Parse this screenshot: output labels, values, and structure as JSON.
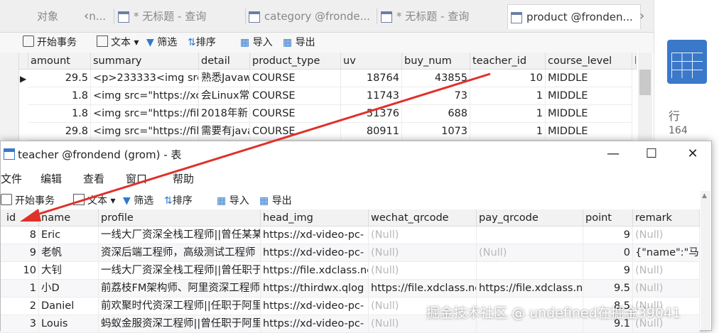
{
  "bg": {
    "tabs": [
      {
        "label": "对象"
      },
      {
        "label": "n..."
      },
      {
        "label": "* 无标题 - 查询"
      },
      {
        "label": "category @fronde..."
      },
      {
        "label": "* 无标题 - 查询"
      },
      {
        "label": "product @fronden..."
      }
    ],
    "toolbar": {
      "begin": "开始事务",
      "text": "文本",
      "filter": "筛选",
      "sort": "排序",
      "import": "导入",
      "export": "导出"
    },
    "columns": [
      "amount",
      "summary",
      "detail",
      "product_type",
      "uv",
      "buy_num",
      "teacher_id",
      "course_level",
      "l"
    ],
    "rows": [
      [
        "29.5",
        "<p>233333<img src",
        "熟悉Javaw",
        "COURSE",
        "18764",
        "43855",
        "10",
        "MIDDLE"
      ],
      [
        "1.8",
        "<img src=\"https://xc",
        "会Linux常",
        "COURSE",
        "11743",
        "73",
        "1",
        "MIDDLE"
      ],
      [
        "1.8",
        "<img src=\"https://fil",
        "2018年新",
        "COURSE",
        "51376",
        "688",
        "1",
        "MIDDLE"
      ],
      [
        "29.8",
        "<img src=\"https://fil",
        "需要有java",
        "COURSE",
        "80911",
        "1073",
        "1",
        "MIDDLE"
      ]
    ],
    "side": {
      "label": "行",
      "count": "164"
    }
  },
  "win": {
    "title": "teacher @frondend (grom) - 表",
    "menu": [
      "文件",
      "编辑",
      "查看",
      "窗口",
      "帮助"
    ],
    "toolbar": {
      "begin": "开始事务",
      "text": "文本",
      "filter": "筛选",
      "sort": "排序",
      "import": "导入",
      "export": "导出"
    },
    "columns": [
      "id",
      "name",
      "profile",
      "head_img",
      "wechat_qrcode",
      "pay_qrcode",
      "point",
      "remark"
    ],
    "rows": [
      [
        "8",
        "Eric",
        "一线大厂资深全栈工程师||曾任某某",
        "https://xd-video-pc-",
        "(Null)",
        "",
        "9",
        "(Null)"
      ],
      [
        "9",
        "老帆",
        "资深后端工程师，高级测试工程师",
        "https://xd-video-pc-",
        "(Null)",
        "(Null)",
        "0",
        "{\"name\":\"马云"
      ],
      [
        "10",
        "大钊",
        "一线大厂资深全栈工程师||曾任职于",
        "https://file.xdclass.ne",
        "(Null)",
        "",
        "9",
        "(Null)"
      ],
      [
        "1",
        "小D",
        "前荔枝FM架构师、阿里资深工程师",
        "https://thirdwx.qlog",
        "https://file.xdclass.ne",
        "https://file.xdclass.ne",
        "9.5",
        "(Null)"
      ],
      [
        "2",
        "Daniel",
        "前欢聚时代资深工程师||任职于阿里",
        "https://xd-video-pc-",
        "(Null)",
        "",
        "8.5",
        "(Null)"
      ],
      [
        "3",
        "Louis",
        "蚂蚁金服资深工程师||曾任职于阿里",
        "https://xd-video-pc-",
        "(Null)",
        "",
        "9.1",
        "(Null)"
      ]
    ]
  },
  "watermark": "掘金技术社区 @ undefined在掘金39041",
  "colors": {
    "arrow": "#e0302a",
    "accent": "#3a78c9"
  }
}
